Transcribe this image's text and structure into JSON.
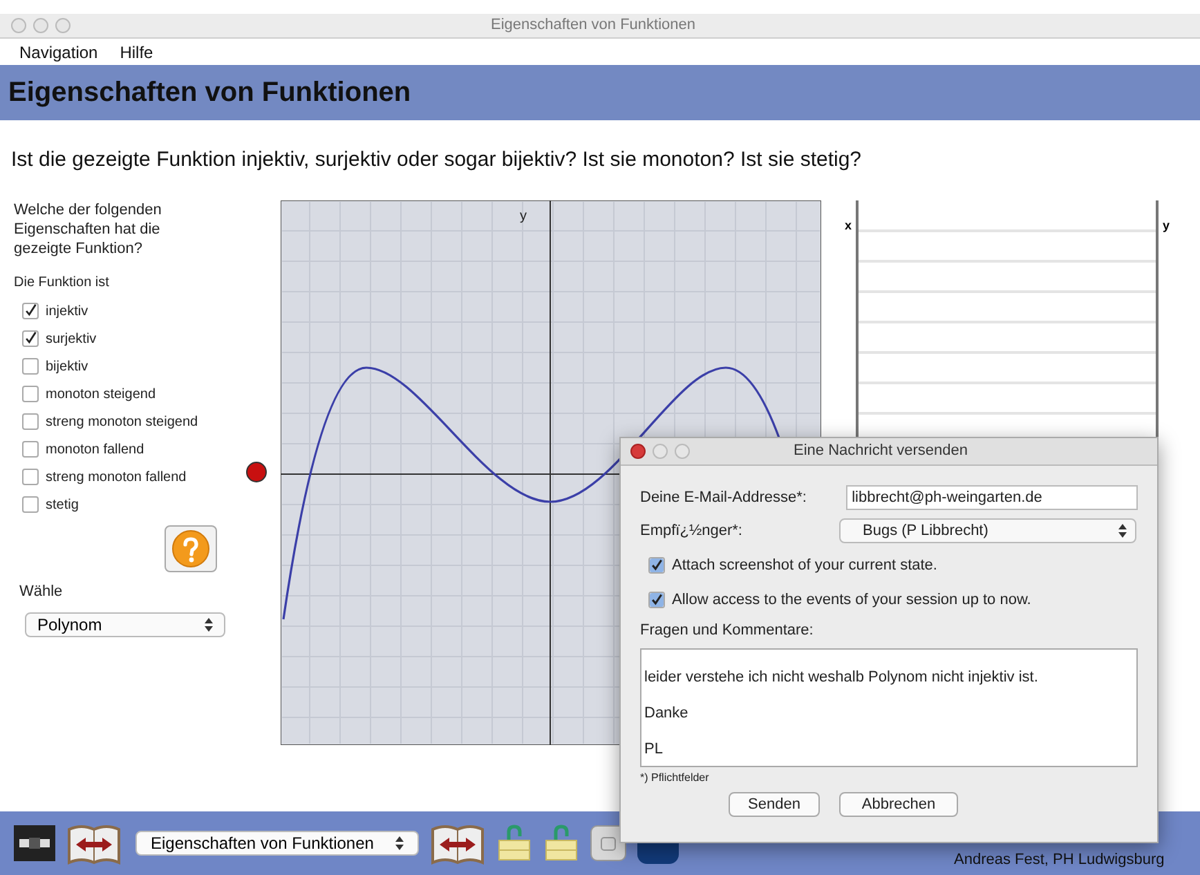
{
  "window": {
    "title": "Eigenschaften von Funktionen"
  },
  "menu": [
    "Navigation",
    "Hilfe"
  ],
  "header": "Eigenschaften von Funktionen",
  "question": "Ist die gezeigte Funktion injektiv, surjektiv oder sogar bijektiv? Ist sie monoton? Ist sie stetig?",
  "sidebar": {
    "prompt": "Welche der folgenden Eigenschaften hat die gezeigte Funktion?",
    "group_label": "Die Funktion ist",
    "options": [
      {
        "label": "injektiv",
        "checked": true
      },
      {
        "label": "surjektiv",
        "checked": true
      },
      {
        "label": "bijektiv",
        "checked": false
      },
      {
        "label": "monoton steigend",
        "checked": false
      },
      {
        "label": "streng monoton steigend",
        "checked": false
      },
      {
        "label": "monoton fallend",
        "checked": false
      },
      {
        "label": "streng monoton fallend",
        "checked": false
      },
      {
        "label": "stetig",
        "checked": false
      }
    ],
    "choose_label": "Wähle",
    "choose_value": "Polynom"
  },
  "graph": {
    "y_axis_label": "y"
  },
  "table": {
    "columns": [
      "x",
      "y"
    ]
  },
  "toolbar": {
    "topic": "Eigenschaften von Funktionen",
    "credit": "Andreas Fest, PH Ludwigsburg"
  },
  "dialog": {
    "title": "Eine Nachricht versenden",
    "email_label": "Deine E-Mail-Addresse*:",
    "email_value": "libbrecht@ph-weingarten.de",
    "recipient_label": "Empfï¿½nger*:",
    "recipient_value": "Bugs (P Libbrecht)",
    "options": [
      {
        "label": "Attach screenshot of your current state.",
        "checked": true
      },
      {
        "label": "Allow access to the events of your session up to now.",
        "checked": true
      }
    ],
    "comments_label": "Fragen und Kommentare:",
    "comment": "leider verstehe ich nicht weshalb Polynom nicht injektiv ist.\n\nDanke\n\nPL",
    "required_note": "*) Pflichtfelder",
    "buttons": [
      "Senden",
      "Abbrechen"
    ]
  }
}
